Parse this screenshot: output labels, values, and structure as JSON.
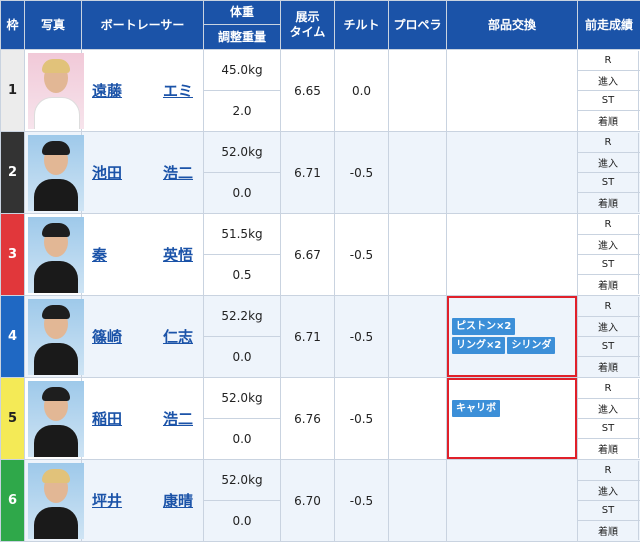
{
  "headers": {
    "waku": "枠",
    "photo": "写真",
    "racer": "ボートレーサー",
    "weight_top": "体重",
    "weight_bottom": "調整重量",
    "tenji_line1": "展示",
    "tenji_line2": "タイム",
    "tilt": "チルト",
    "propeller": "プロペラ",
    "parts": "部品交換",
    "zenso": "前走成績"
  },
  "zenso_labels": [
    "R",
    "進入",
    "ST",
    "着順"
  ],
  "colors": {
    "header_bg": "#1b53a8",
    "waku1": "#ececec",
    "waku2": "#333333",
    "waku3": "#e1373b",
    "waku4": "#1f68c3",
    "waku5": "#f4ea56",
    "waku6": "#2fa84a",
    "badge": "#3c8fd8",
    "highlight_box": "#e0202a"
  },
  "racers": [
    {
      "waku": "1",
      "surname": "遠藤",
      "given": "エミ",
      "weight": "45.0kg",
      "adjust": "2.0",
      "tenji": "6.65",
      "tilt": "0.0",
      "propeller": "",
      "parts": [],
      "photo": "racer-photo-female"
    },
    {
      "waku": "2",
      "surname": "池田",
      "given": "浩二",
      "weight": "52.0kg",
      "adjust": "0.0",
      "tenji": "6.71",
      "tilt": "-0.5",
      "propeller": "",
      "parts": [],
      "photo": "racer-photo"
    },
    {
      "waku": "3",
      "surname": "秦",
      "given": "英悟",
      "weight": "51.5kg",
      "adjust": "0.5",
      "tenji": "6.67",
      "tilt": "-0.5",
      "propeller": "",
      "parts": [],
      "photo": "racer-photo"
    },
    {
      "waku": "4",
      "surname": "篠崎",
      "given": "仁志",
      "weight": "52.2kg",
      "adjust": "0.0",
      "tenji": "6.71",
      "tilt": "-0.5",
      "propeller": "",
      "parts": [
        "ピストン×2",
        "リング×2",
        "シリンダ"
      ],
      "photo": "racer-photo",
      "highlighted": true
    },
    {
      "waku": "5",
      "surname": "稲田",
      "given": "浩二",
      "weight": "52.0kg",
      "adjust": "0.0",
      "tenji": "6.76",
      "tilt": "-0.5",
      "propeller": "",
      "parts": [
        "キャリボ"
      ],
      "photo": "racer-photo",
      "highlighted": true
    },
    {
      "waku": "6",
      "surname": "坪井",
      "given": "康晴",
      "weight": "52.0kg",
      "adjust": "0.0",
      "tenji": "6.70",
      "tilt": "-0.5",
      "propeller": "",
      "parts": [],
      "photo": "racer-photo"
    }
  ]
}
